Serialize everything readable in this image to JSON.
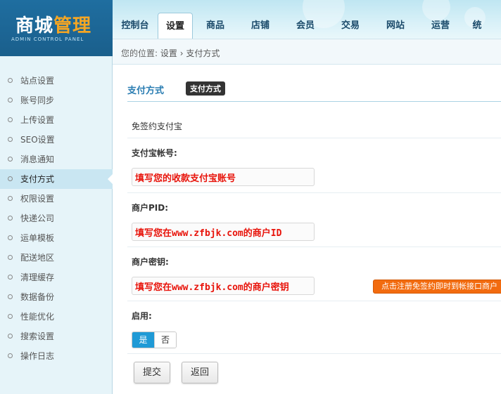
{
  "logo": {
    "title_white": "商城",
    "title_orange": "管理",
    "subtitle": "ADMIN CONTROL PANEL"
  },
  "nav": {
    "items": [
      "控制台",
      "设置",
      "商品",
      "店铺",
      "会员",
      "交易",
      "网站",
      "运营",
      "统"
    ],
    "active_index": 1
  },
  "breadcrumb": {
    "prefix": "您的位置:",
    "level1": "设置",
    "separator": "›",
    "level2": "支付方式"
  },
  "sidebar": {
    "items": [
      "站点设置",
      "账号同步",
      "上传设置",
      "SEO设置",
      "消息通知",
      "支付方式",
      "权限设置",
      "快递公司",
      "运单模板",
      "配送地区",
      "清理缓存",
      "数据备份",
      "性能优化",
      "搜索设置",
      "操作日志"
    ],
    "active_index": 5
  },
  "main": {
    "section_title": "支付方式",
    "section_badge": "支付方式",
    "plan_text": "免签约支付宝",
    "account_label": "支付宝帐号:",
    "account_value": "填写您的收款支付宝账号",
    "pid_label": "商户PID:",
    "pid_value": "填写您在www.zfbjk.com的商户ID",
    "key_label": "商户密钥:",
    "key_value": "填写您在www.zfbjk.com的商户密钥",
    "register_hint": "点击注册免签约即时到帐接口商户",
    "enable_label": "启用:",
    "enable_yes": "是",
    "enable_no": "否",
    "enabled": true,
    "submit_label": "提交",
    "back_label": "返回"
  },
  "colors": {
    "accent": "#2a7db2",
    "toggle_on": "#1f9ad6",
    "hint_orange": "#f26b0f",
    "field_text_red": "#e8130a",
    "logo_orange": "#f5a623"
  }
}
